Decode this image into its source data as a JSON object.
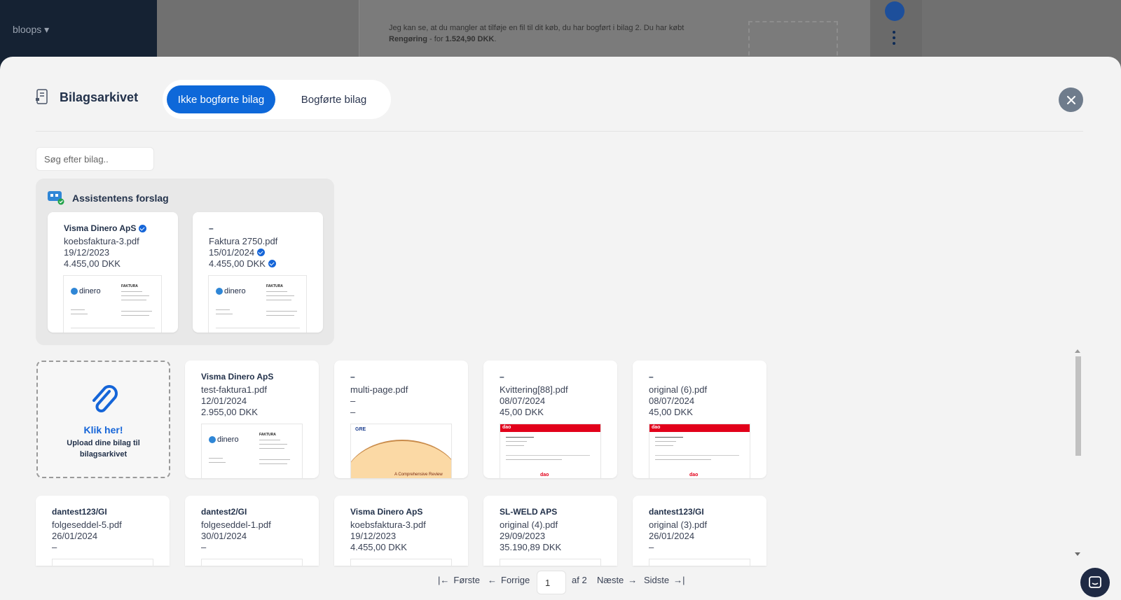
{
  "background": {
    "brand": "bloops",
    "message_pre": "Jeg kan se, at du mangler at tilføje en fil til dit køb, du har bogført i bilag 2. Du har købt ",
    "message_item": "Rengøring",
    "message_mid": " - for ",
    "message_amount": "1.524,90 DKK",
    "message_post": "."
  },
  "header": {
    "title": "Bilagsarkivet",
    "tabs": [
      {
        "label": "Ikke bogførte bilag",
        "active": true
      },
      {
        "label": "Bogførte bilag",
        "active": false
      }
    ]
  },
  "search": {
    "placeholder": "Søg efter bilag.."
  },
  "suggestions": {
    "title": "Assistentens forslag",
    "cards": [
      {
        "vendor": "Visma Dinero ApS",
        "vendor_verified": true,
        "file": "koebsfaktura-3.pdf",
        "date": "19/12/2023",
        "amount": "4.455,00 DKK",
        "thumb": "dinero"
      },
      {
        "vendor": "–",
        "file": "Faktura 2750.pdf",
        "date": "15/01/2024",
        "date_verified": true,
        "amount": "4.455,00 DKK",
        "amount_verified": true,
        "thumb": "dinero"
      }
    ]
  },
  "upload": {
    "title": "Klik her!",
    "subtitle": "Upload dine bilag til bilagsarkivet"
  },
  "cards": [
    {
      "vendor": "Visma Dinero ApS",
      "file": "test-faktura1.pdf",
      "date": "12/01/2024",
      "amount": "2.955,00 DKK",
      "thumb": "dinero"
    },
    {
      "vendor": "–",
      "file": "multi-page.pdf",
      "date": "–",
      "amount": "–",
      "thumb": "gre"
    },
    {
      "vendor": "–",
      "file": "Kvittering[88].pdf",
      "date": "08/07/2024",
      "amount": "45,00 DKK",
      "thumb": "dao"
    },
    {
      "vendor": "–",
      "file": "original (6).pdf",
      "date": "08/07/2024",
      "amount": "45,00 DKK",
      "thumb": "dao"
    },
    {
      "vendor": "dantest123/GI",
      "file": "folgeseddel-5.pdf",
      "date": "26/01/2024",
      "amount": "–",
      "thumb": "blank"
    },
    {
      "vendor": "dantest2/GI",
      "file": "folgeseddel-1.pdf",
      "date": "30/01/2024",
      "amount": "–",
      "thumb": "blank"
    },
    {
      "vendor": "Visma Dinero ApS",
      "file": "koebsfaktura-3.pdf",
      "date": "19/12/2023",
      "amount": "4.455,00 DKK",
      "thumb": "blank"
    },
    {
      "vendor": "SL-WELD APS",
      "file": "original (4).pdf",
      "date": "29/09/2023",
      "amount": "35.190,89 DKK",
      "thumb": "blank"
    },
    {
      "vendor": "dantest123/GI",
      "file": "original (3).pdf",
      "date": "26/01/2024",
      "amount": "–",
      "thumb": "blank"
    }
  ],
  "thumb_text": {
    "dinero": "dinero",
    "faktura": "FAKTURA",
    "gre_logo": "GRE",
    "gre_caption": "A Comprehensive Review",
    "dao": "dao"
  },
  "pagination": {
    "first": "Første",
    "prev": "Forrige",
    "current": "1",
    "of": "af 2",
    "next": "Næste",
    "last": "Sidste"
  },
  "colors": {
    "accent": "#0e68d9",
    "verified": "#1565d8",
    "dao_red": "#e2001a"
  }
}
